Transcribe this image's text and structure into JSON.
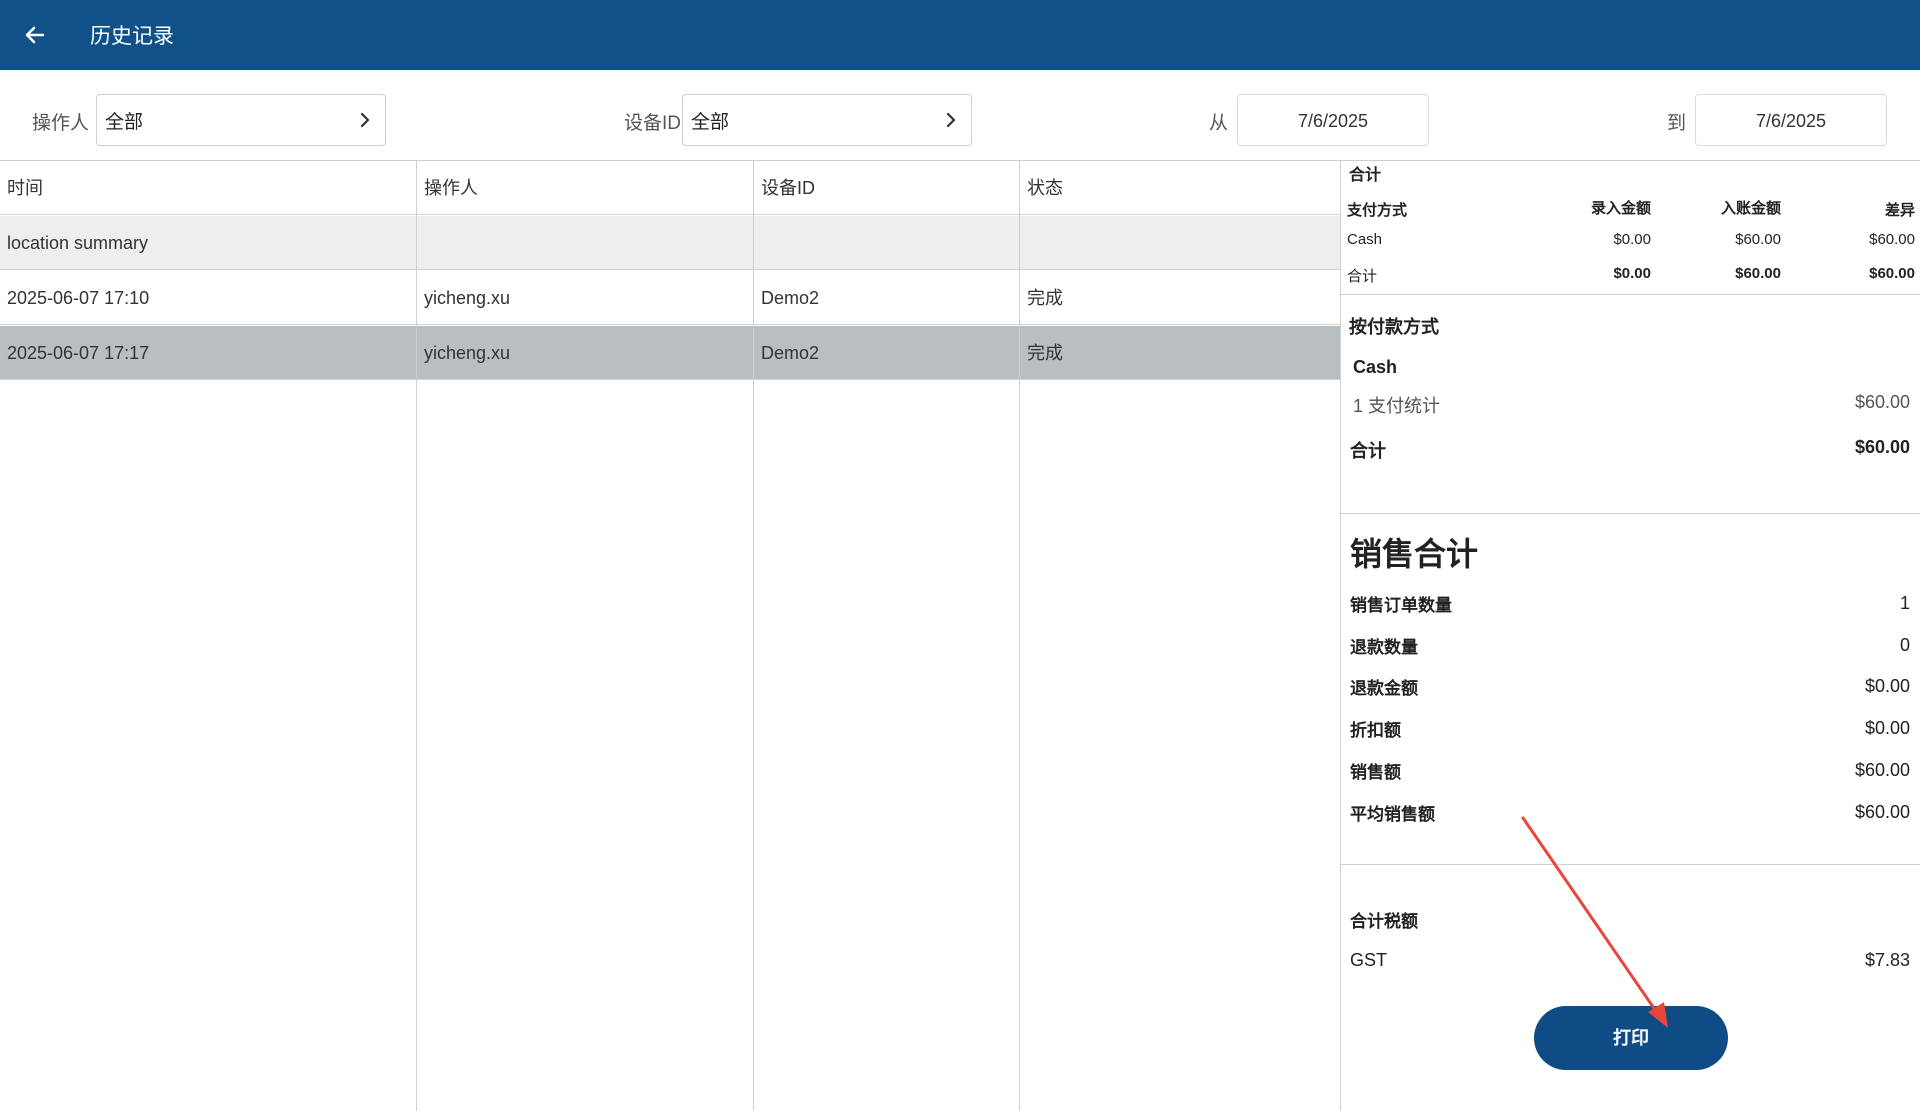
{
  "header": {
    "title": "历史记录"
  },
  "filters": {
    "operator_label": "操作人",
    "operator_value": "全部",
    "device_label": "设备ID",
    "device_value": "全部",
    "from_label": "从",
    "from_value": "7/6/2025",
    "to_label": "到",
    "to_value": "7/6/2025"
  },
  "table": {
    "columns": [
      "时间",
      "操作人",
      "设备ID",
      "状态"
    ],
    "summary_row": "location summary",
    "rows": [
      [
        "2025-06-07 17:10",
        "yicheng.xu",
        "Demo2",
        "完成"
      ],
      [
        "2025-06-07 17:17",
        "yicheng.xu",
        "Demo2",
        "完成"
      ]
    ]
  },
  "summary": {
    "total_header": "合计",
    "pay_table": {
      "columns": [
        "支付方式",
        "录入金额",
        "入账金额",
        "差异"
      ],
      "rows": [
        [
          "Cash",
          "$0.00",
          "$60.00",
          "$60.00"
        ],
        [
          "合计",
          "$0.00",
          "$60.00",
          "$60.00"
        ]
      ]
    },
    "by_payment": {
      "title": "按付款方式",
      "method": "Cash",
      "count_label": "1 支付统计",
      "count_value": "$60.00",
      "total_label": "合计",
      "total_value": "$60.00"
    },
    "sales": {
      "title": "销售合计",
      "items": [
        {
          "label": "销售订单数量",
          "value": "1"
        },
        {
          "label": "退款数量",
          "value": "0"
        },
        {
          "label": "退款金额",
          "value": "$0.00"
        },
        {
          "label": "折扣额",
          "value": "$0.00"
        },
        {
          "label": "销售额",
          "value": "$60.00"
        },
        {
          "label": "平均销售额",
          "value": "$60.00"
        }
      ]
    },
    "tax": {
      "title": "合计税额",
      "label": "GST",
      "value": "$7.83"
    },
    "print_label": "打印"
  },
  "colors": {
    "header_bg": "#0f5188",
    "button_bg": "#0f4c86",
    "selected_row": "#b9bec3",
    "annotation_arrow": "#e8463a"
  },
  "icons": {
    "back": "arrow-left-icon",
    "chevron": "chevron-right-icon"
  }
}
